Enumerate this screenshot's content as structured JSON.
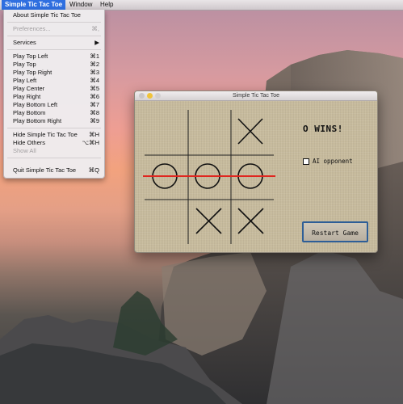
{
  "menubar": {
    "app_name": "Simple Tic Tac Toe",
    "items": [
      "Window",
      "Help"
    ]
  },
  "app_menu": {
    "items": [
      {
        "label": "About Simple Tic Tac Toe",
        "shortcut": "",
        "enabled": true
      },
      {
        "label": "Preferences...",
        "shortcut": "⌘,",
        "enabled": false
      },
      {
        "label": "Services",
        "shortcut": "▶",
        "enabled": true
      },
      {
        "label": "Play Top Left",
        "shortcut": "⌘1",
        "enabled": true
      },
      {
        "label": "Play Top",
        "shortcut": "⌘2",
        "enabled": true
      },
      {
        "label": "Play Top Right",
        "shortcut": "⌘3",
        "enabled": true
      },
      {
        "label": "Play Left",
        "shortcut": "⌘4",
        "enabled": true
      },
      {
        "label": "Play Center",
        "shortcut": "⌘5",
        "enabled": true
      },
      {
        "label": "Play Right",
        "shortcut": "⌘6",
        "enabled": true
      },
      {
        "label": "Play Bottom Left",
        "shortcut": "⌘7",
        "enabled": true
      },
      {
        "label": "Play Bottom",
        "shortcut": "⌘8",
        "enabled": true
      },
      {
        "label": "Play Bottom Right",
        "shortcut": "⌘9",
        "enabled": true
      },
      {
        "label": "Hide Simple Tic Tac Toe",
        "shortcut": "⌘H",
        "enabled": true
      },
      {
        "label": "Hide Others",
        "shortcut": "⌥⌘H",
        "enabled": true
      },
      {
        "label": "Show All",
        "shortcut": "",
        "enabled": false
      },
      {
        "label": "Quit Simple Tic Tac Toe",
        "shortcut": "⌘Q",
        "enabled": true
      }
    ]
  },
  "window": {
    "title": "Simple Tic Tac Toe",
    "status": "O WINS!",
    "ai_opponent_label": "AI opponent",
    "ai_opponent_checked": false,
    "restart_label": "Restart Game",
    "board": [
      [
        "",
        "",
        "X"
      ],
      [
        "O",
        "O",
        "O"
      ],
      [
        "",
        "X",
        "X"
      ]
    ],
    "winning_line": "middle-row",
    "winning_line_color": "#e0261f"
  }
}
